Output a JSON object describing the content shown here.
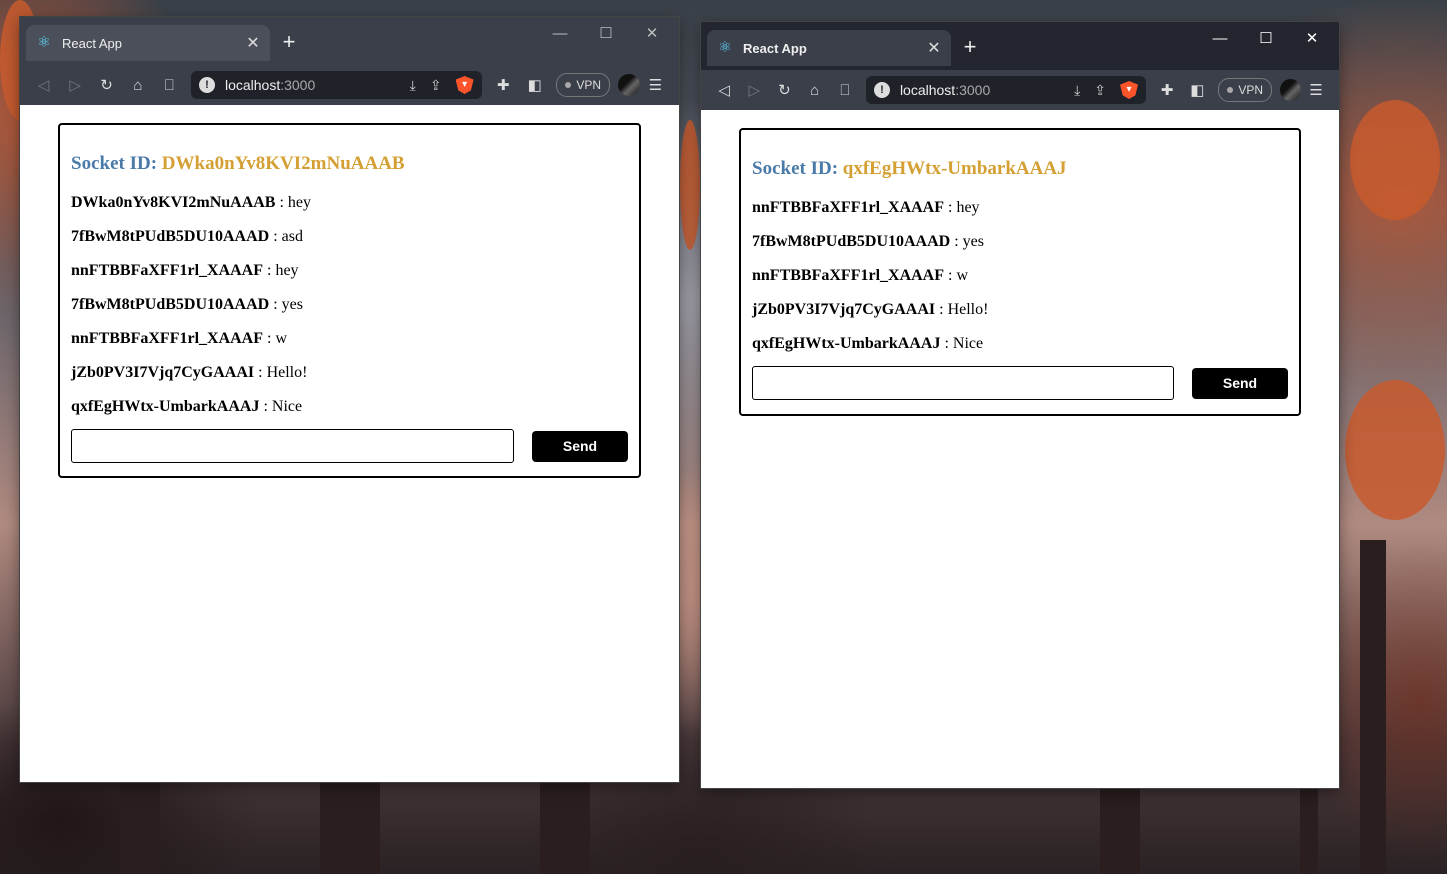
{
  "windows": [
    {
      "tab_title": "React App",
      "url_host": "localhost",
      "url_port": ":3000",
      "vpn_label": "VPN",
      "socket_label": "Socket ID:",
      "socket_id": "DWka0nYv8KVI2mNuAAAB",
      "messages": [
        {
          "sender": "DWka0nYv8KVI2mNuAAAB",
          "text": " : hey"
        },
        {
          "sender": "7fBwM8tPUdB5DU10AAAD",
          "text": " : asd"
        },
        {
          "sender": "nnFTBBFaXFF1rl_XAAAF",
          "text": " : hey"
        },
        {
          "sender": "7fBwM8tPUdB5DU10AAAD",
          "text": " : yes"
        },
        {
          "sender": "nnFTBBFaXFF1rl_XAAAF",
          "text": " : w"
        },
        {
          "sender": "jZb0PV3I7Vjq7CyGAAAI",
          "text": " : Hello!"
        },
        {
          "sender": "qxfEgHWtx-UmbarkAAAJ",
          "text": " : Nice"
        }
      ],
      "input_value": "",
      "send_label": "Send"
    },
    {
      "tab_title": "React App",
      "url_host": "localhost",
      "url_port": ":3000",
      "vpn_label": "VPN",
      "socket_label": "Socket ID:",
      "socket_id": "qxfEgHWtx-UmbarkAAAJ",
      "messages": [
        {
          "sender": "nnFTBBFaXFF1rl_XAAAF",
          "text": " : hey"
        },
        {
          "sender": "7fBwM8tPUdB5DU10AAAD",
          "text": " : yes"
        },
        {
          "sender": "nnFTBBFaXFF1rl_XAAAF",
          "text": " : w"
        },
        {
          "sender": "jZb0PV3I7Vjq7CyGAAAI",
          "text": " : Hello!"
        },
        {
          "sender": "qxfEgHWtx-UmbarkAAAJ",
          "text": " : Nice"
        }
      ],
      "input_value": "",
      "send_label": "Send"
    }
  ],
  "colors": {
    "socket_label": "#4a7aa8",
    "socket_id": "#d4a033",
    "send_button": "#000000"
  },
  "icons": [
    "react-favicon-icon",
    "close-tab-icon",
    "new-tab-icon",
    "minimize-icon",
    "maximize-icon",
    "close-window-icon",
    "back-icon",
    "forward-icon",
    "reload-icon",
    "home-icon",
    "bookmark-icon",
    "site-info-icon",
    "install-icon",
    "share-icon",
    "brave-shields-icon",
    "extensions-icon",
    "sidebar-icon",
    "profile-avatar-icon",
    "menu-icon"
  ]
}
